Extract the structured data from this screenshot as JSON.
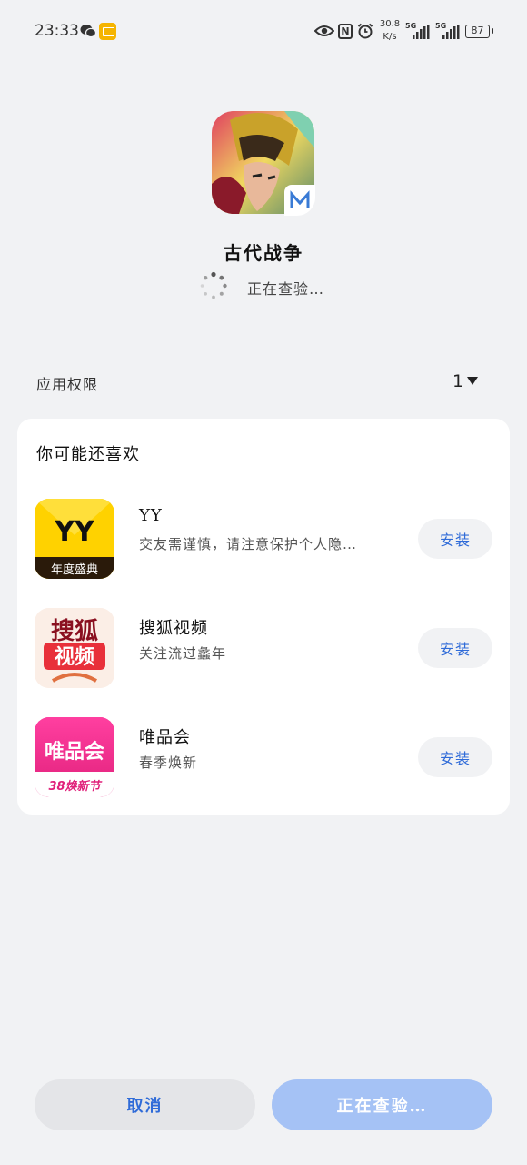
{
  "status_bar": {
    "time": "23:33",
    "net_speed_value": "30.8",
    "net_speed_unit": "K/s",
    "network_1": "5G",
    "network_2": "5G",
    "battery": "87",
    "icons": [
      "wechat-icon",
      "mail-icon",
      "eye-icon",
      "nfc-icon",
      "alarm-icon",
      "signal-icon",
      "signal-icon",
      "battery-icon"
    ]
  },
  "app": {
    "name": "古代战争",
    "status": "正在查验…"
  },
  "permissions": {
    "label": "应用权限",
    "count": "1"
  },
  "recommendations": {
    "title": "你可能还喜欢",
    "items": [
      {
        "name": "YY",
        "desc": "交友需谨慎，请注意保护个人隐…",
        "button": "安装",
        "icon_text_top": "YY",
        "icon_text_bottom": "年度盛典",
        "accent": "#ffd200"
      },
      {
        "name": "搜狐视频",
        "desc": "关注流过蠡年",
        "button": "安装",
        "icon_text_top": "搜狐",
        "icon_text_bottom": "视频",
        "accent": "#e8303a"
      },
      {
        "name": "唯品会",
        "desc": "春季焕新",
        "button": "安装",
        "icon_text_top": "唯品会",
        "icon_text_bottom": "38焕新节",
        "accent": "#f0308f"
      }
    ]
  },
  "buttons": {
    "cancel": "取消",
    "primary": "正在查验…"
  },
  "colors": {
    "background": "#f1f2f4",
    "link_blue": "#2f6bd8",
    "primary_disabled": "#a5c2f5"
  }
}
